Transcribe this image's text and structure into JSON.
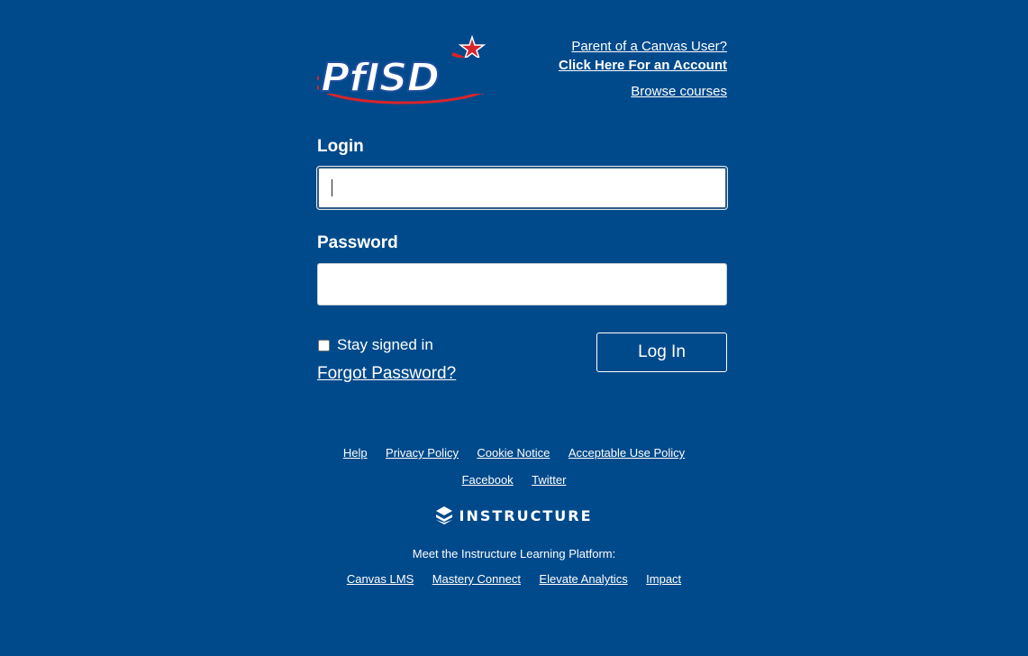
{
  "header": {
    "logo_text": "PfISD",
    "parent_link_line1": "Parent of a Canvas User?",
    "parent_link_line2": "Click Here For an Account",
    "browse_link": "Browse courses"
  },
  "form": {
    "login_label": "Login",
    "login_value": "",
    "password_label": "Password",
    "password_value": "",
    "remember_label": "Stay signed in",
    "remember_checked": false,
    "forgot_link": "Forgot Password?",
    "submit_label": "Log In"
  },
  "footer": {
    "links_row1": [
      "Help",
      "Privacy Policy",
      "Cookie Notice",
      "Acceptable Use Policy"
    ],
    "links_row2": [
      "Facebook",
      "Twitter"
    ],
    "brand": "INSTRUCTURE",
    "platform_text": "Meet the Instructure Learning Platform:",
    "links_row3": [
      "Canvas LMS",
      "Mastery Connect",
      "Elevate Analytics",
      "Impact"
    ]
  },
  "colors": {
    "background": "#004a8b",
    "logo_blue": "#1d4f9c",
    "logo_red": "#d7252c",
    "text": "#ffffff"
  }
}
